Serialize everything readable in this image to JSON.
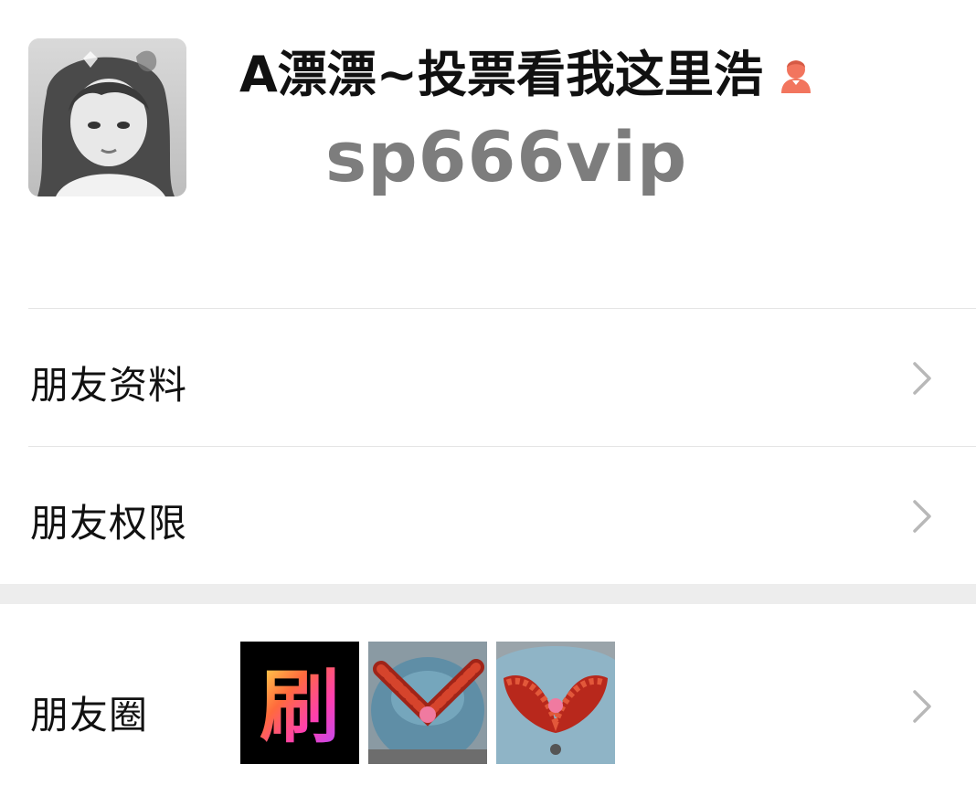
{
  "profile": {
    "display_name": "A漂漂~投票看我这里浩",
    "wechat_id": "sp666vip",
    "avatar_icon": "user-avatar-photo",
    "gender_icon": "female-icon",
    "gender_color": "#f2755e"
  },
  "menu": {
    "friend_info_label": "朋友资料",
    "friend_permissions_label": "朋友权限",
    "moments_label": "朋友圈",
    "chevron_icon": "chevron-right-icon"
  },
  "moments": {
    "thumb1_text": "刷",
    "thumbnails": [
      "moments-thumb-text-image",
      "moments-thumb-wedding-car",
      "moments-thumb-wedding-car-front"
    ]
  },
  "colors": {
    "divider": "#e5e5e5",
    "section_gap": "#ededed",
    "id_text": "#7d7d7d"
  }
}
